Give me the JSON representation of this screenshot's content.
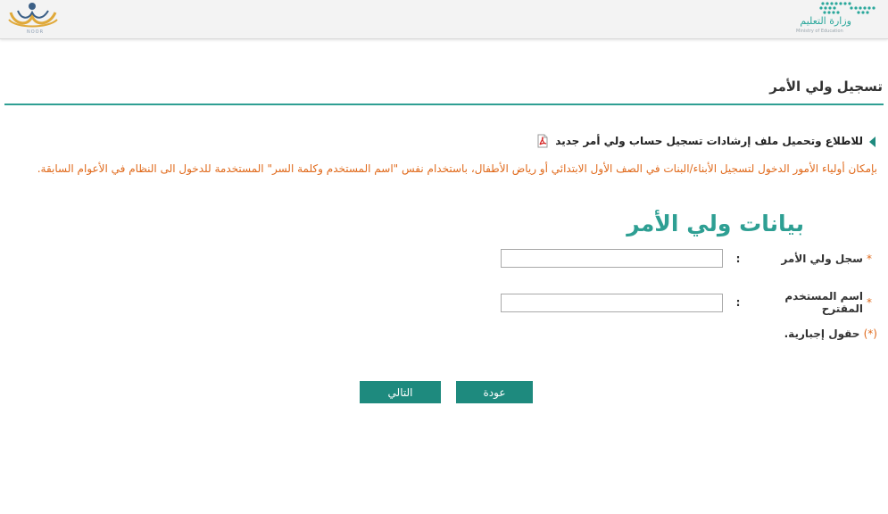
{
  "header": {
    "noor_logo_caption": "NOOR",
    "ministry_logo_arabic": "وزارة التعليم",
    "ministry_logo_english": "Ministry of Education"
  },
  "page": {
    "title": "تسجيل ولي الأمر"
  },
  "instructions": {
    "link_text": "للاطلاع وتحميل ملف إرشادات تسجيل حساب ولي أمر جديد",
    "notice": "بإمكان أولياء الأمور الدخول لتسجيل الأبناء/البنات في الصف الأول الابتدائي أو رياض الأطفال، باستخدام نفس \"اسم المستخدم وكلمة السر\" المستخدمة للدخول الى النظام في الأعوام السابقة."
  },
  "form": {
    "heading": "بيانات ولي الأمر",
    "required_marker": "*",
    "colon": ":",
    "fields": [
      {
        "label": "سجل ولي الأمر",
        "value": ""
      },
      {
        "label": "اسم المستخدم المقترح",
        "value": ""
      }
    ],
    "required_note_prefix": "(*)",
    "required_note_text": "حقول إجبارية."
  },
  "buttons": {
    "back": "عودة",
    "next": "التالي"
  },
  "colors": {
    "accent": "#1e8a7e",
    "heading": "#2e9f93",
    "notice": "#e06a1c"
  }
}
